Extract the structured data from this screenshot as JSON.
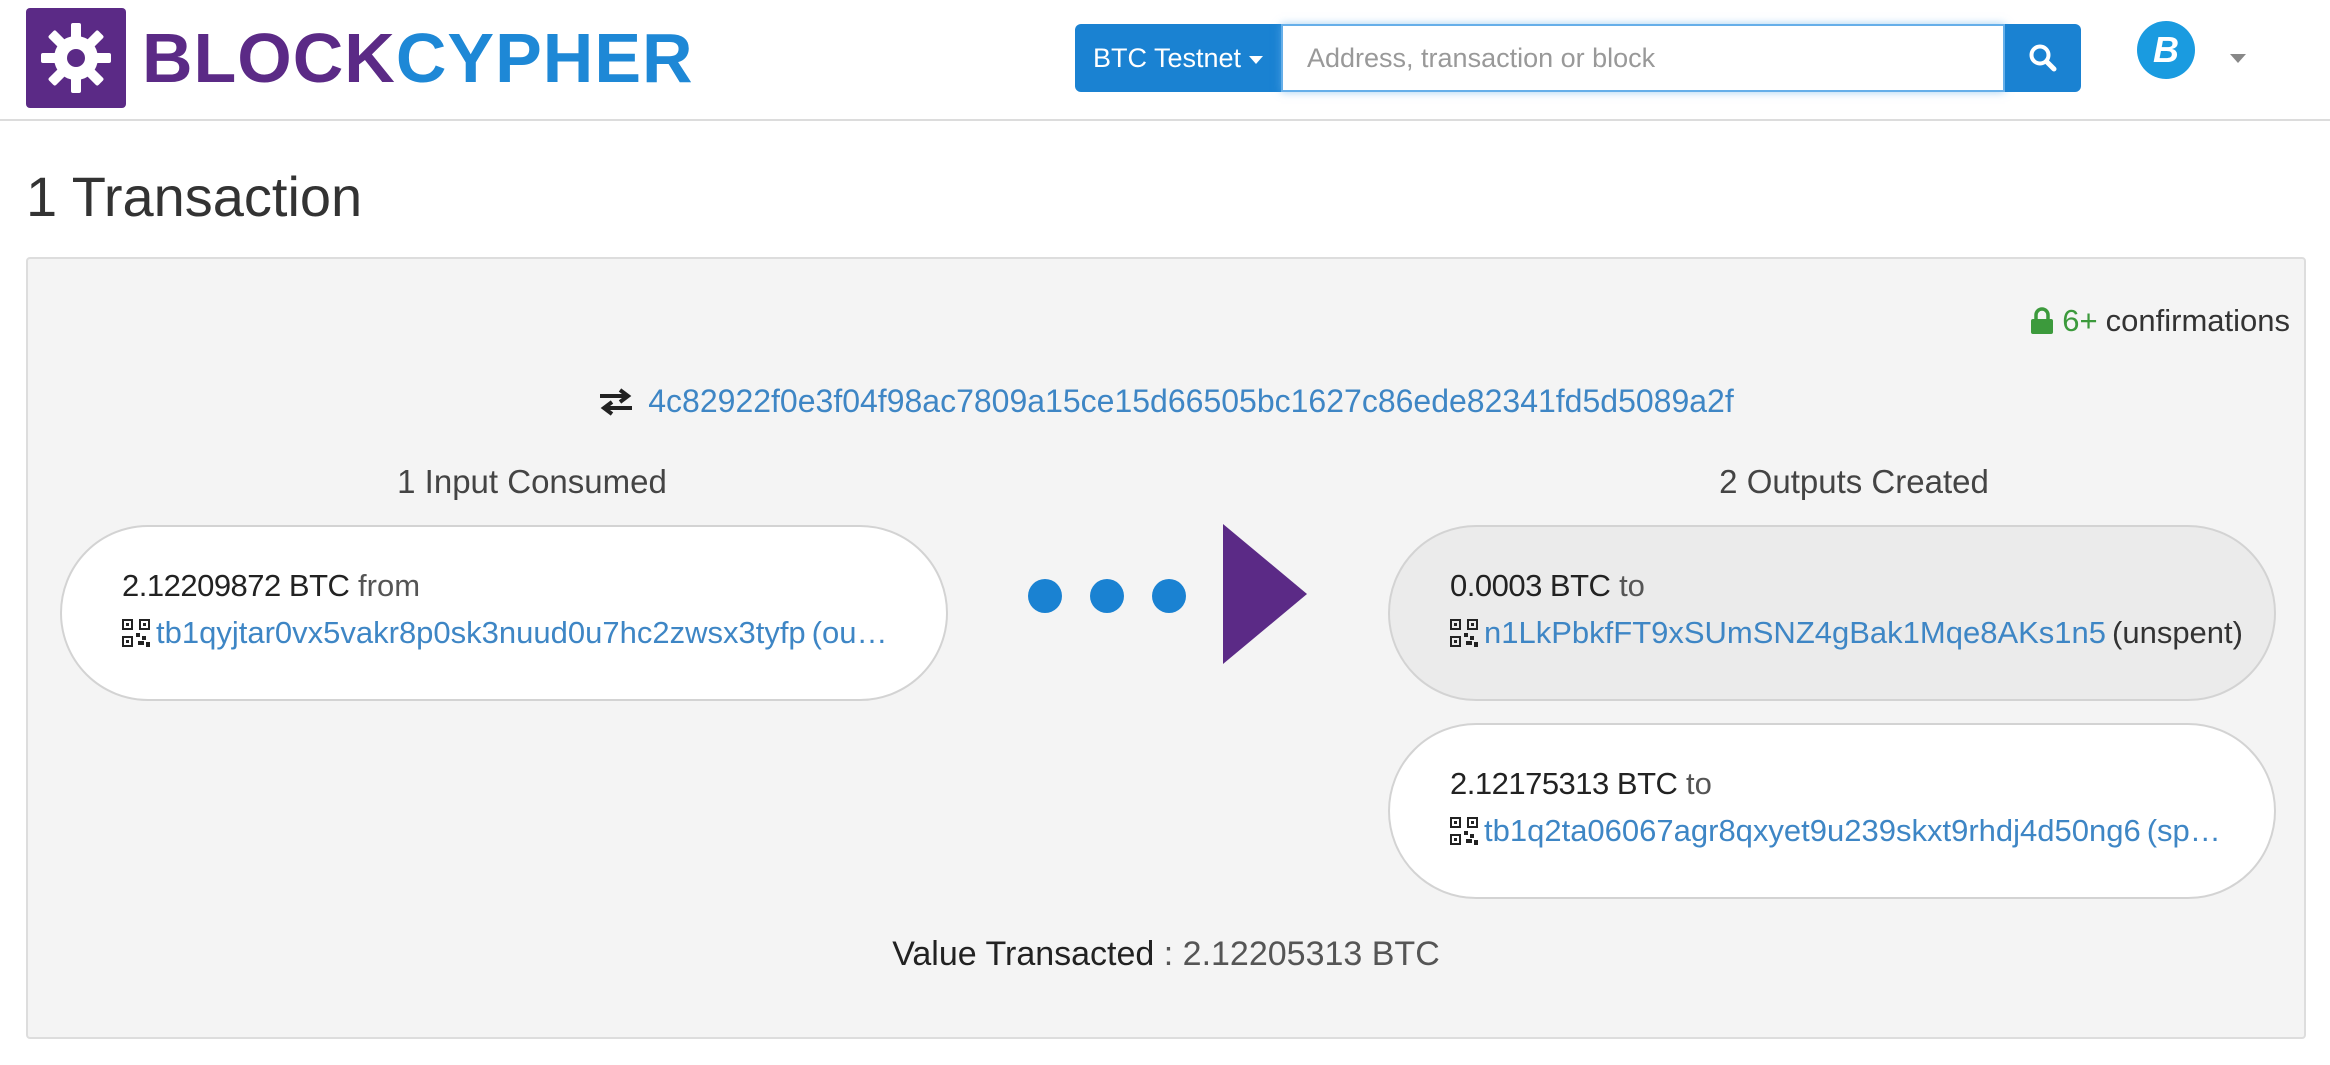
{
  "header": {
    "logo_part1": "BLOCK",
    "logo_part2": "CYPHER",
    "network_label": "BTC Testnet",
    "search_placeholder": "Address, transaction or block",
    "coin_symbol": "B"
  },
  "page": {
    "title": "1 Transaction"
  },
  "transaction": {
    "confirmations_count": "6+",
    "confirmations_label": "confirmations",
    "hash": "4c82922f0e3f04f98ac7809a15ce15d66505bc1627c86ede82341fd5d5089a2f",
    "inputs_title": "1 Input Consumed",
    "outputs_title": "2 Outputs Created",
    "inputs": [
      {
        "amount": "2.12209872 BTC",
        "direction": "from",
        "address": "tb1qyjtar0vx5vakr8p0sk3nuud0u7hc2zwsx3tyfp",
        "status": "(ou…"
      }
    ],
    "outputs": [
      {
        "amount": "0.0003 BTC",
        "direction": "to",
        "address": "n1LkPbkfFT9xSUmSNZ4gBak1Mqe8AKs1n5",
        "status": "(unspent)"
      },
      {
        "amount": "2.12175313 BTC",
        "direction": "to",
        "address": "tb1q2ta06067agr8qxyet9u239skxt9rhdj4d50ng6",
        "status": "(sp…"
      }
    ],
    "value_label": "Value Transacted",
    "value_separator": " : ",
    "value_amount": "2.12205313 BTC"
  },
  "colors": {
    "brand_purple": "#5b2a86",
    "brand_blue": "#1a82d2",
    "link_blue": "#3e86c5",
    "confirm_green": "#3c9a3c"
  },
  "icons": [
    "gear-logo-icon",
    "caret-down-icon",
    "search-icon",
    "bitcoin-icon",
    "lock-icon",
    "exchange-arrows-icon",
    "qr-code-icon",
    "play-arrow-icon"
  ]
}
